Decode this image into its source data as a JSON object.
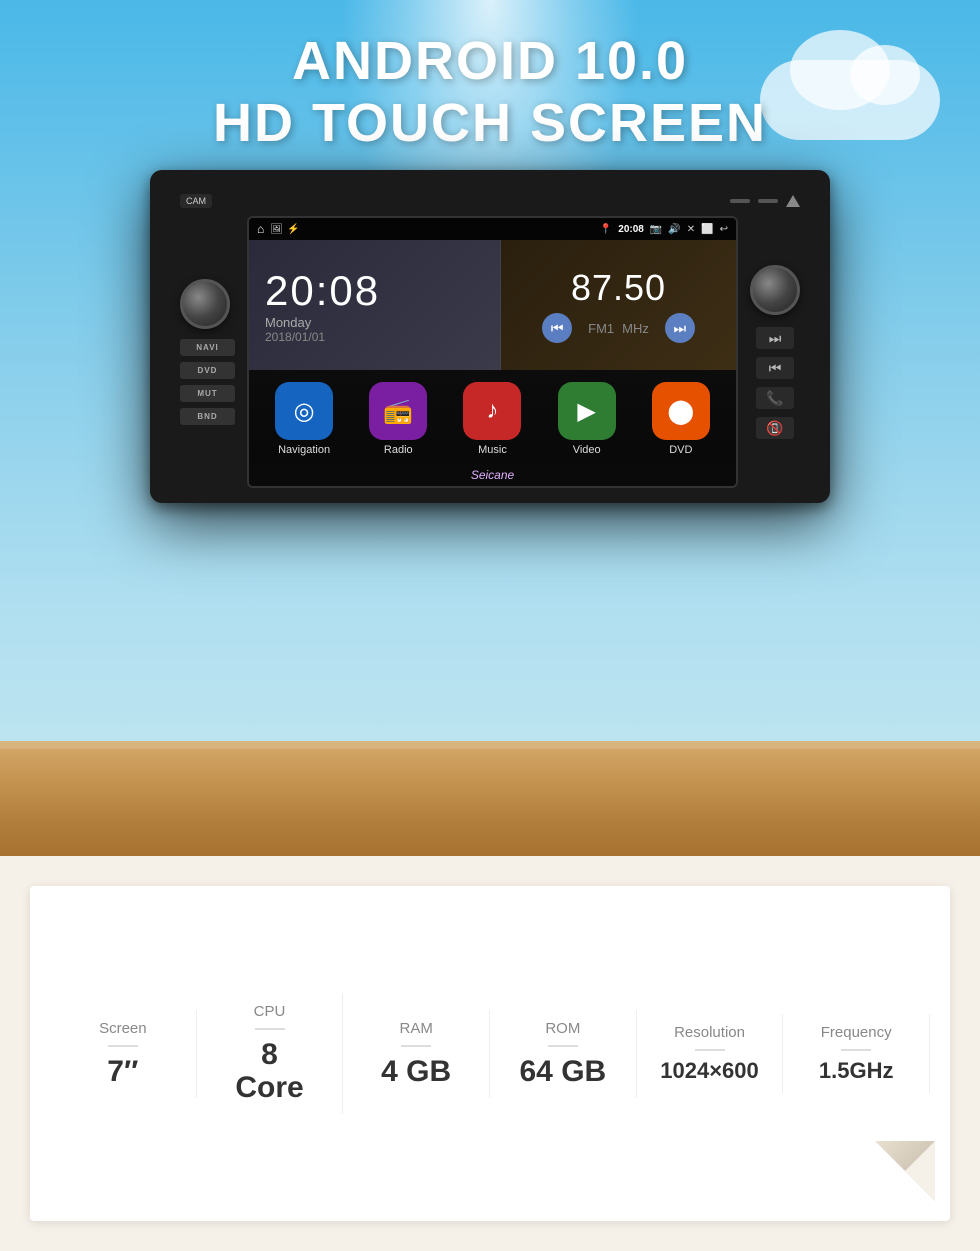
{
  "hero": {
    "line1": "ANDROID 10.0",
    "line2": "HD TOUCH SCREEN"
  },
  "status_bar": {
    "time": "20:08",
    "home_icon": "⌂"
  },
  "clock_widget": {
    "time": "20:08",
    "day": "Monday",
    "date": "2018/01/01"
  },
  "radio_widget": {
    "frequency": "87.50",
    "band": "FM1",
    "unit": "MHz"
  },
  "apps": [
    {
      "label": "Navigation",
      "icon": "◎",
      "color_class": "app-icon-nav"
    },
    {
      "label": "Radio",
      "icon": "📻",
      "color_class": "app-icon-radio"
    },
    {
      "label": "Music",
      "icon": "♪",
      "color_class": "app-icon-music"
    },
    {
      "label": "Video",
      "icon": "▶",
      "color_class": "app-icon-video"
    },
    {
      "label": "DVD",
      "icon": "⬤",
      "color_class": "app-icon-dvd"
    }
  ],
  "watermark": "Seicane",
  "side_buttons_left": [
    "NAVI",
    "DVD",
    "MUT",
    "BND"
  ],
  "specs": [
    {
      "label": "Screen",
      "value": "7\""
    },
    {
      "label": "CPU",
      "value": "8\nCore"
    },
    {
      "label": "RAM",
      "value": "4 GB"
    },
    {
      "label": "ROM",
      "value": "64 GB"
    },
    {
      "label": "Resolution",
      "value": "1024×600"
    },
    {
      "label": "Frequency",
      "value": "1.5GHz"
    }
  ]
}
